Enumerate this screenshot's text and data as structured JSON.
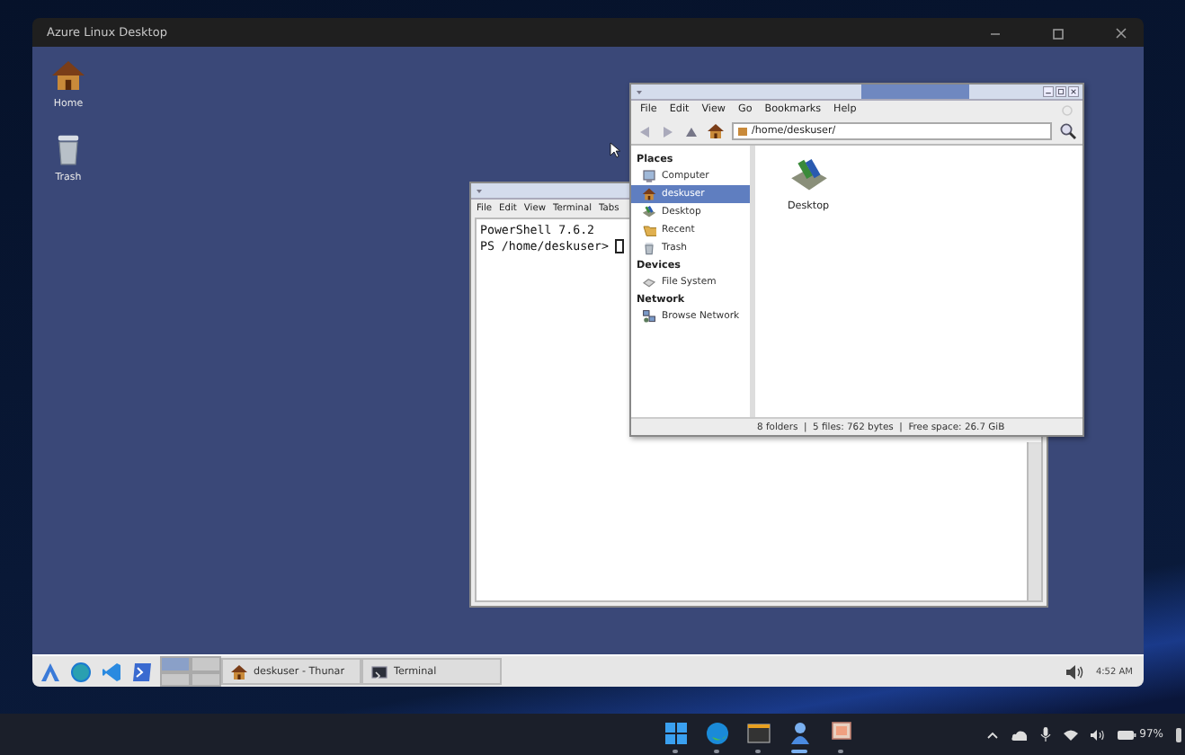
{
  "host_window": {
    "title": "Azure Linux Desktop"
  },
  "desktop_icons": [
    {
      "label": "Home",
      "kind": "home"
    },
    {
      "label": "Trash",
      "kind": "trash"
    }
  ],
  "terminal": {
    "menu": [
      "File",
      "Edit",
      "View",
      "Terminal",
      "Tabs"
    ],
    "lines": [
      "PowerShell 7.6.2",
      "PS /home/deskuser> "
    ]
  },
  "file_manager": {
    "menu": [
      "File",
      "Edit",
      "View",
      "Go",
      "Bookmarks",
      "Help"
    ],
    "path": "/home/deskuser/",
    "sidebar": [
      {
        "heading": "Places",
        "items": [
          {
            "label": "Computer",
            "kind": "computer",
            "selected": false
          },
          {
            "label": "deskuser",
            "kind": "home",
            "selected": true
          },
          {
            "label": "Desktop",
            "kind": "desktop",
            "selected": false
          },
          {
            "label": "Recent",
            "kind": "folder",
            "selected": false
          },
          {
            "label": "Trash",
            "kind": "trash",
            "selected": false
          }
        ]
      },
      {
        "heading": "Devices",
        "items": [
          {
            "label": "File System",
            "kind": "drive",
            "selected": false
          }
        ]
      },
      {
        "heading": "Network",
        "items": [
          {
            "label": "Browse Network",
            "kind": "network",
            "selected": false
          }
        ]
      }
    ],
    "files": [
      {
        "label": "Desktop",
        "kind": "desktop"
      }
    ],
    "status": "8 folders  |  5 files: 762 bytes  |  Free space: 26.7 GiB"
  },
  "panel": {
    "launchers": [
      {
        "kind": "azure"
      },
      {
        "kind": "globe"
      },
      {
        "kind": "code"
      },
      {
        "kind": "shell"
      }
    ],
    "tasks": [
      {
        "label": "deskuser - Thunar",
        "kind": "home"
      },
      {
        "label": "Terminal",
        "kind": "terminal"
      }
    ],
    "clock": "4:52 AM"
  },
  "windows_taskbar": {
    "apps": [
      {
        "kind": "start",
        "selected": false
      },
      {
        "kind": "edge",
        "selected": false
      },
      {
        "kind": "terminal",
        "selected": false
      },
      {
        "kind": "azure",
        "selected": true
      },
      {
        "kind": "remote",
        "selected": false
      }
    ],
    "battery": "97%"
  }
}
